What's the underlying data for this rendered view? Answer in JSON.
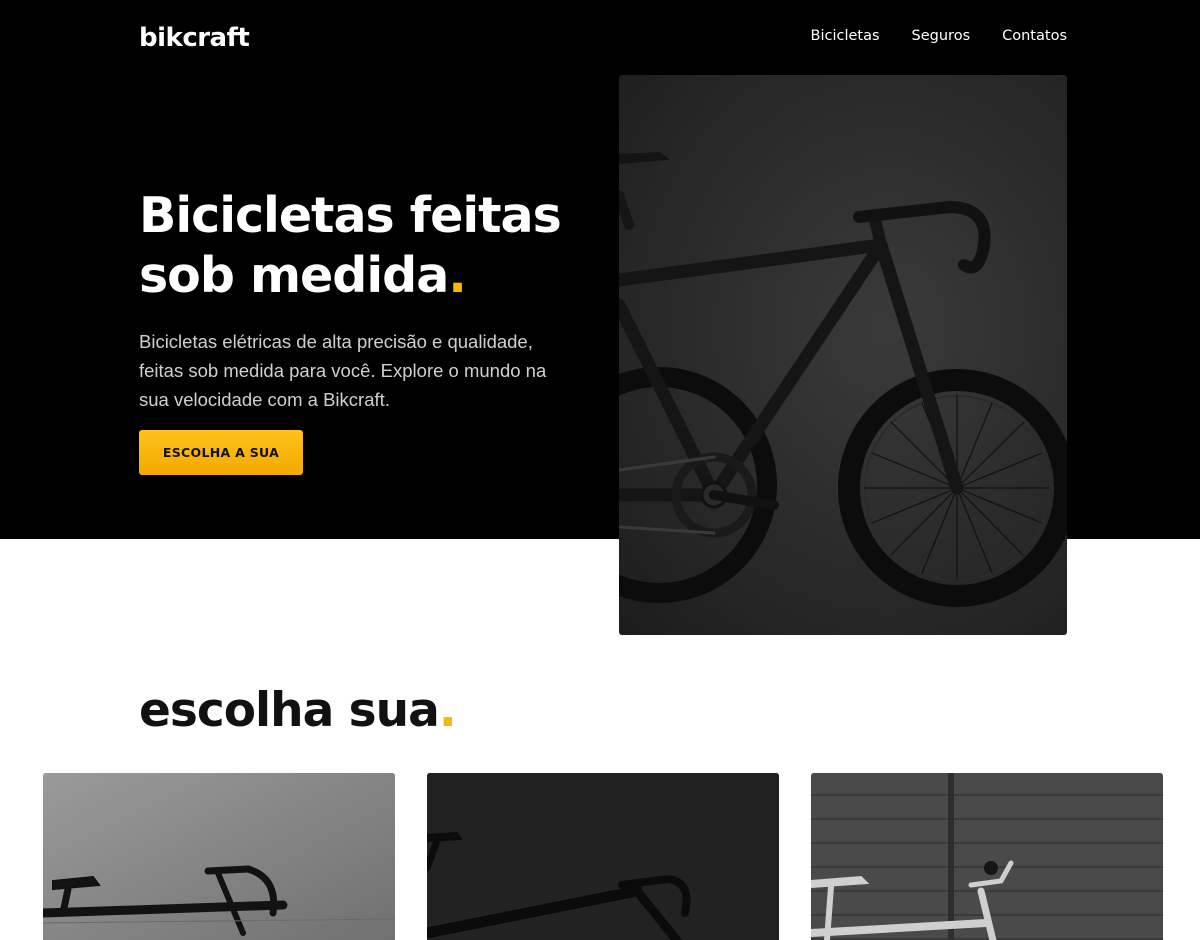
{
  "header": {
    "logo": "bikcraft",
    "nav": [
      {
        "label": "Bicicletas"
      },
      {
        "label": "Seguros"
      },
      {
        "label": "Contatos"
      }
    ]
  },
  "hero": {
    "title_line1": "Bicicletas feitas",
    "title_line2": "sob medida",
    "title_dot": ".",
    "description": "Bicicletas elétricas de alta precisão e qualidade, feitas sob medida para você. Explore o mundo na sua velocidade com a Bikcraft.",
    "cta_label": "ESCOLHA A SUA",
    "image": "bicycle-photo"
  },
  "section": {
    "title": "escolha sua",
    "title_dot": ".",
    "cards": [
      {
        "image": "bicycle-photo-light-wall"
      },
      {
        "image": "bicycle-photo-dark"
      },
      {
        "image": "bicycle-photo-wood-wall"
      }
    ]
  },
  "colors": {
    "accent": "#fbb800",
    "hero_bg": "#000000",
    "page_bg": "#ffffff",
    "text_dark": "#111111"
  }
}
